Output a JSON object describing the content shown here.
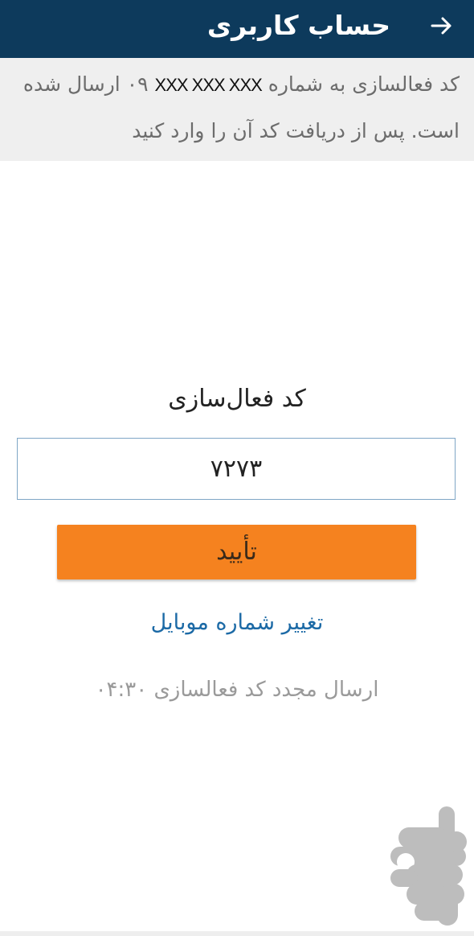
{
  "header": {
    "title": "حساب کاربری",
    "back_icon": "arrow-right-icon",
    "background_color": "#0d3a5c"
  },
  "notice": {
    "line1_before": "کد فعالسازی به شماره",
    "phone_prefix": "۰۹",
    "phone_masked": "XXX XXX XXX",
    "line1_after": "ارسال شده",
    "line2": "است. پس از دریافت کد آن را وارد کنید"
  },
  "form": {
    "code_label": "کد فعال‌سازی",
    "code_value": "۷۲۷۳",
    "confirm_label": "تأیید",
    "confirm_color": "#f5821f",
    "change_mobile_label": "تغییر شماره موبایل",
    "resend_label": "ارسال مجدد کد فعالسازی",
    "resend_timer": "۰۴:۳۰"
  },
  "branding": {
    "logo_icon": "app-store-logo-icon"
  }
}
